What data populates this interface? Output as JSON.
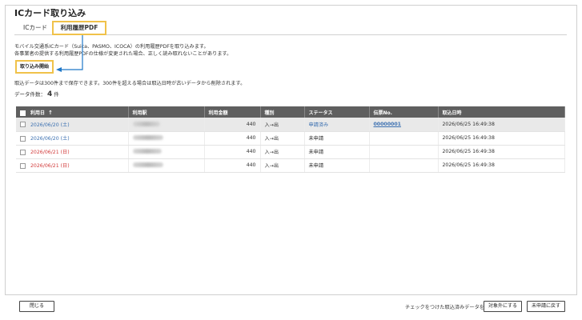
{
  "page": {
    "title": "ICカード取り込み"
  },
  "tabs": [
    {
      "label": "ICカード"
    },
    {
      "label": "利用履歴PDF"
    }
  ],
  "description": {
    "line1": "モバイル交通系ICカード（Suica、PASMO、ICOCA）の利用履歴PDFを取り込みます。",
    "line2": "各事業者の提供する利用履歴PDFの仕様が変更された場合、正しく読み取れないことがあります。"
  },
  "import_button": "取り込み開始",
  "note": "取込データは300件まで保存できます。300件を超える場合は取込日時が古いデータから削除されます。",
  "count": {
    "label": "データ件数：",
    "value": "4",
    "unit": "件"
  },
  "table": {
    "headers": [
      "利用日",
      "利用駅",
      "利用金額",
      "種別",
      "ステータス",
      "伝票No.",
      "取込日時"
    ],
    "sort_indicator": "↑",
    "rows": [
      {
        "date": "2026/06/20 (土)",
        "amount": "440",
        "type": "入→出",
        "status": "申請済み",
        "slip": "00000001",
        "imported": "2026/06/25 16:49:38"
      },
      {
        "date": "2026/06/20 (土)",
        "amount": "440",
        "type": "入→出",
        "status": "未申請",
        "slip": "",
        "imported": "2026/06/25 16:49:38"
      },
      {
        "date": "2026/06/21 (日)",
        "amount": "440",
        "type": "入→出",
        "status": "未申請",
        "slip": "",
        "imported": "2026/06/25 16:49:38"
      },
      {
        "date": "2026/06/21 (日)",
        "amount": "440",
        "type": "入→出",
        "status": "未申請",
        "slip": "",
        "imported": "2026/06/25 16:49:38"
      }
    ]
  },
  "footer": {
    "close": "閉じる",
    "label": "チェックをつけた取込済みデータを",
    "exclude": "対象外にする",
    "revert": "未申請に戻す"
  },
  "colors": {
    "highlight": "#f0c24a",
    "arrow": "#1f77c8",
    "header_bg": "#5f5f5f",
    "link": "#3a6fb0",
    "weekend": "#d23b3b"
  }
}
